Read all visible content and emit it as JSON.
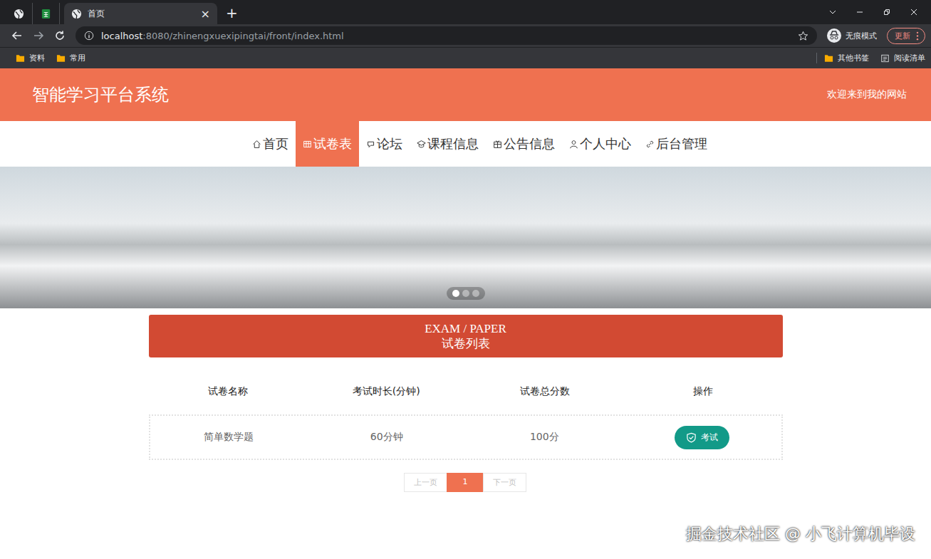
{
  "browser": {
    "tabs": [
      {
        "kind": "globe",
        "selected": false,
        "label": ""
      },
      {
        "kind": "sheet",
        "selected": false,
        "label": ""
      },
      {
        "kind": "page",
        "selected": true,
        "label": "首页"
      }
    ],
    "close": "×",
    "new_tab": "+",
    "url_host": "localhost",
    "url_rest": ":8080/zhinengxuexipingtai/front/index.html",
    "incognito": "无痕模式",
    "update": "更新",
    "bookmarks_left": [
      "资料",
      "常用"
    ],
    "bookmarks_right": [
      "其他书签",
      "阅读清单"
    ]
  },
  "header": {
    "title": "智能学习平台系统",
    "welcome": "欢迎来到我的网站"
  },
  "nav": [
    {
      "label": "首页",
      "selected": false
    },
    {
      "label": "试卷表",
      "selected": true
    },
    {
      "label": "论坛",
      "selected": false
    },
    {
      "label": "课程信息",
      "selected": false
    },
    {
      "label": "公告信息",
      "selected": false
    },
    {
      "label": "个人中心",
      "selected": false
    },
    {
      "label": "后台管理",
      "selected": false
    }
  ],
  "carousel": {
    "slides": [
      {
        "selected": true
      },
      {
        "selected": false
      },
      {
        "selected": false
      }
    ]
  },
  "section": {
    "title_en": "EXAM / PAPER",
    "title_cn": "试卷列表"
  },
  "table": {
    "columns": [
      "试卷名称",
      "考试时长(分钟)",
      "试卷总分数",
      "操作"
    ],
    "rows": [
      {
        "name": "简单数学题",
        "duration": "60分钟",
        "score": "100分",
        "action": "考试"
      }
    ]
  },
  "pagination": {
    "prev": {
      "label": "上一页",
      "disabled": true
    },
    "pages": [
      {
        "label": "1",
        "selected": true
      }
    ],
    "next": {
      "label": "下一页",
      "disabled": true
    }
  },
  "watermark": "掘金技术社区 @ 小飞计算机毕设"
}
